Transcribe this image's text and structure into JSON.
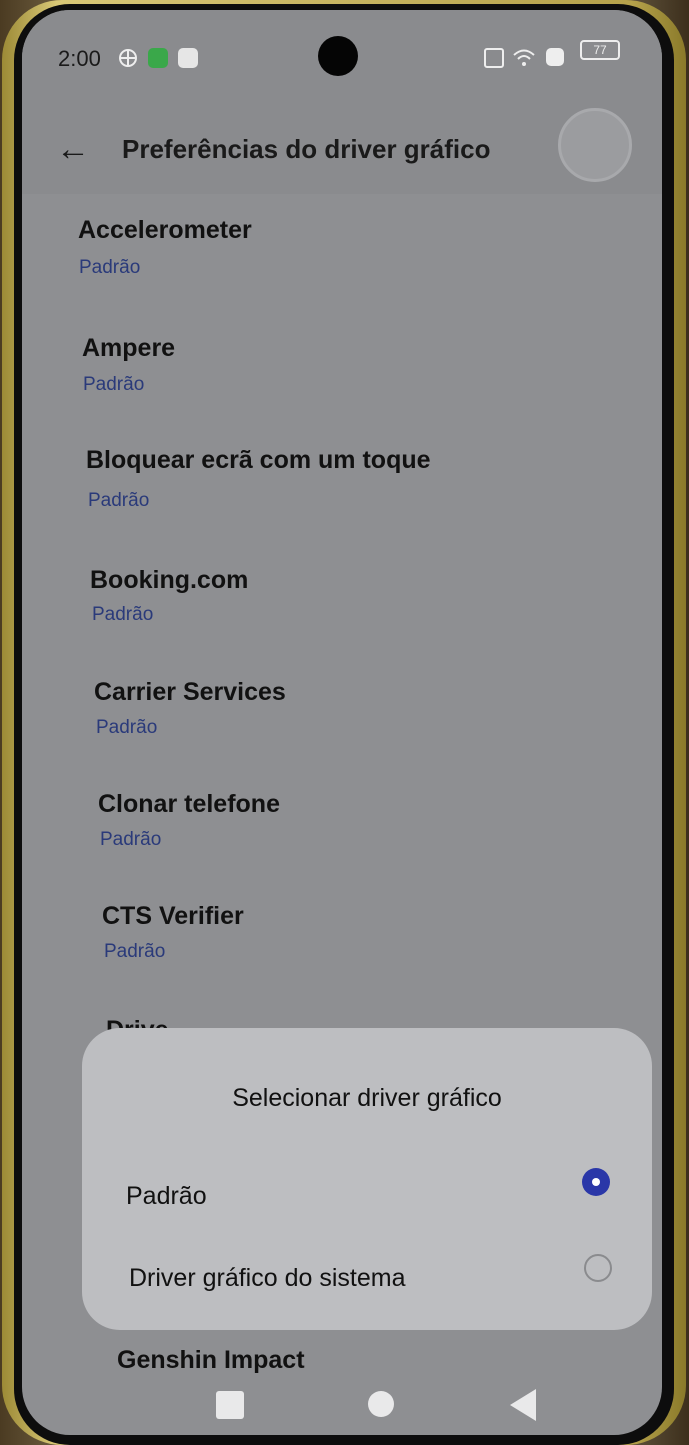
{
  "status_bar": {
    "time": "2:00",
    "battery": "77",
    "icons": [
      "vpn-icon",
      "sim-icon",
      "message-icon",
      "nfc-icon",
      "wifi-icon",
      "no-sim-icon",
      "battery-icon"
    ]
  },
  "app_bar": {
    "title": "Preferências do driver gráfico",
    "back_icon": "←"
  },
  "list": {
    "items": [
      {
        "title": "Accelerometer",
        "subtitle": "Padrão"
      },
      {
        "title": "Ampere",
        "subtitle": "Padrão"
      },
      {
        "title": "Bloquear ecrã com um toque",
        "subtitle": "Padrão"
      },
      {
        "title": "Booking.com",
        "subtitle": "Padrão"
      },
      {
        "title": "Carrier Services",
        "subtitle": "Padrão"
      },
      {
        "title": "Clonar telefone",
        "subtitle": "Padrão"
      },
      {
        "title": "CTS Verifier",
        "subtitle": "Padrão"
      },
      {
        "title": "Drive",
        "subtitle": ""
      },
      {
        "title": "Genshin Impact",
        "subtitle": ""
      }
    ]
  },
  "dialog": {
    "title": "Selecionar driver gráfico",
    "options": [
      {
        "label": "Padrão",
        "selected": true
      },
      {
        "label": "Driver gráfico do sistema",
        "selected": false
      }
    ]
  },
  "colors": {
    "accent": "#2a37a8",
    "subtitle": "#2a3a7a",
    "screen_bg": "#8e8f92",
    "dialog_bg": "#bdbec1"
  }
}
